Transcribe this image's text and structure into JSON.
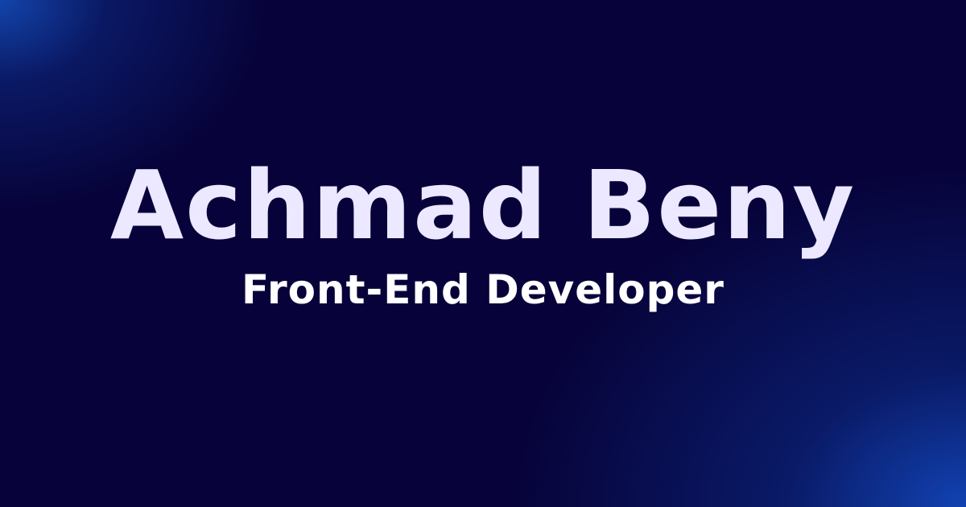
{
  "hero": {
    "name": "Achmad Beny",
    "role": "Front-End Developer"
  },
  "colors": {
    "background": "#07033a",
    "glow": "#1446b9",
    "name_text": "#ece8ff",
    "role_text": "#ffffff"
  }
}
